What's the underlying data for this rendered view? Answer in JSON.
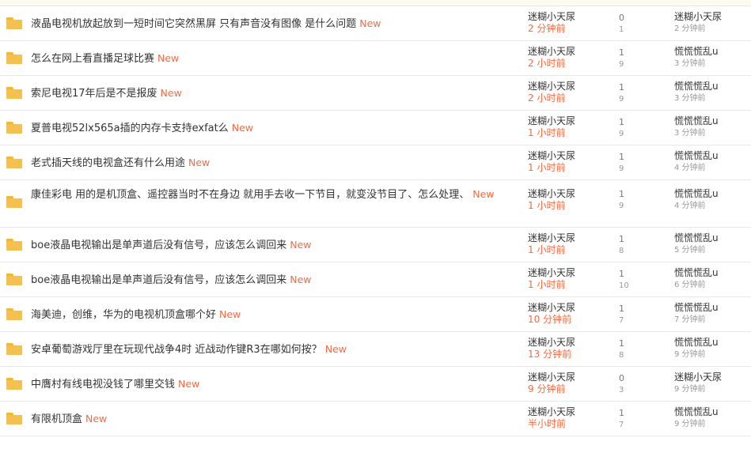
{
  "threads": [
    {
      "title": "液晶电视机放起放到一短时间它突然黑屏 只有声音没有图像 是什么问题",
      "badge": "New",
      "author": "迷糊小天尿",
      "post_time": "2 分钟前",
      "replies": "0",
      "views": "1",
      "last_poster": "迷糊小天尿",
      "last_time": "2 分钟前"
    },
    {
      "title": "怎么在网上看直播足球比赛",
      "badge": "New",
      "author": "迷糊小天尿",
      "post_time": "2 小时前",
      "replies": "1",
      "views": "9",
      "last_poster": "慌慌慌乱u",
      "last_time": "3 分钟前"
    },
    {
      "title": "索尼电视17年后是不是报废",
      "badge": "New",
      "author": "迷糊小天尿",
      "post_time": "2 小时前",
      "replies": "1",
      "views": "9",
      "last_poster": "慌慌慌乱u",
      "last_time": "3 分钟前"
    },
    {
      "title": "夏普电视52lx565a插的内存卡支持exfat么",
      "badge": "New",
      "author": "迷糊小天尿",
      "post_time": "1 小时前",
      "replies": "1",
      "views": "9",
      "last_poster": "慌慌慌乱u",
      "last_time": "3 分钟前"
    },
    {
      "title": "老式插天线的电视盒还有什么用途",
      "badge": "New",
      "author": "迷糊小天尿",
      "post_time": "1 小时前",
      "replies": "1",
      "views": "9",
      "last_poster": "慌慌慌乱u",
      "last_time": "4 分钟前"
    },
    {
      "title": "康佳彩电 用的是机顶盒、遥控器当时不在身边 就用手去收一下节目，就变没节目了、怎么处理、",
      "badge": "New",
      "author": "迷糊小天尿",
      "post_time": "1 小时前",
      "replies": "1",
      "views": "9",
      "last_poster": "慌慌慌乱u",
      "last_time": "4 分钟前"
    },
    {
      "title": "boe液晶电视输出是单声道后没有信号，应该怎么调回来",
      "badge": "New",
      "author": "迷糊小天尿",
      "post_time": "1 小时前",
      "replies": "1",
      "views": "8",
      "last_poster": "慌慌慌乱u",
      "last_time": "5 分钟前"
    },
    {
      "title": "boe液晶电视输出是单声道后没有信号，应该怎么调回来",
      "badge": "New",
      "author": "迷糊小天尿",
      "post_time": "1 小时前",
      "replies": "1",
      "views": "10",
      "last_poster": "慌慌慌乱u",
      "last_time": "6 分钟前"
    },
    {
      "title": "海美迪，创维，华为的电视机顶盒哪个好",
      "badge": "New",
      "author": "迷糊小天尿",
      "post_time": "10 分钟前",
      "replies": "1",
      "views": "7",
      "last_poster": "慌慌慌乱u",
      "last_time": "7 分钟前"
    },
    {
      "title": "安卓葡萄游戏厅里在玩现代战争4时 近战动作键R3在哪如何按？",
      "badge": "New",
      "author": "迷糊小天尿",
      "post_time": "13 分钟前",
      "replies": "1",
      "views": "8",
      "last_poster": "慌慌慌乱u",
      "last_time": "9 分钟前"
    },
    {
      "title": "中膺村有线电视没钱了哪里交钱",
      "badge": "New",
      "author": "迷糊小天尿",
      "post_time": "9 分钟前",
      "replies": "0",
      "views": "3",
      "last_poster": "迷糊小天尿",
      "last_time": "9 分钟前"
    },
    {
      "title": "有限机顶盒",
      "badge": "New",
      "author": "迷糊小天尿",
      "post_time": "半小时前",
      "replies": "1",
      "views": "7",
      "last_poster": "慌慌慌乱u",
      "last_time": "9 分钟前"
    }
  ],
  "colors": {
    "accent": "#f26b42",
    "folder": "#f4c150"
  }
}
